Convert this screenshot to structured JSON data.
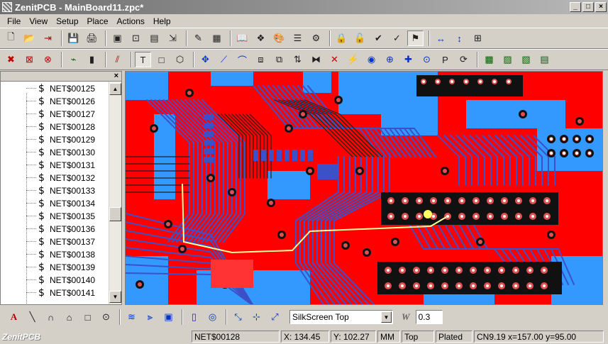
{
  "window": {
    "title": "ZenitPCB - MainBoard11.zpc*"
  },
  "menu": [
    "File",
    "View",
    "Setup",
    "Place",
    "Actions",
    "Help"
  ],
  "toolbar1": [
    "new-icon",
    "open-icon",
    "exit-icon",
    "save-icon",
    "print-icon",
    "board-icon",
    "component-icon",
    "pcb-icon",
    "export-icon",
    "edit-icon",
    "grid-icon",
    "library-icon",
    "layers-icon",
    "palette-icon",
    "properties-icon",
    "design-rules-icon",
    "lock-icon",
    "unlock-icon",
    "check-icon",
    "drc-icon",
    "online-drc-icon",
    "dimension-h-icon",
    "dimension-v-icon",
    "set-icon"
  ],
  "toolbar2": [
    "delete-icon",
    "delete-trace-icon",
    "delete-via-icon",
    "ratsnest-icon",
    "component-pin-icon",
    "route-icon",
    "text-icon",
    "rectangle-icon",
    "polygon-icon",
    "move-icon",
    "line-icon",
    "arc-icon",
    "component2-icon",
    "footprint-icon",
    "swap-icon",
    "gate-icon",
    "unroute-icon",
    "autoroute-icon",
    "via-icon",
    "add-pad-icon",
    "add-cross-icon",
    "add-circle-icon",
    "pad-icon",
    "cycle-icon",
    "copper-icon",
    "copper2-icon",
    "copper3-icon",
    "report-icon"
  ],
  "netlist": {
    "items": [
      "NET$00125",
      "NET$00126",
      "NET$00127",
      "NET$00128",
      "NET$00129",
      "NET$00130",
      "NET$00131",
      "NET$00132",
      "NET$00133",
      "NET$00134",
      "NET$00135",
      "NET$00136",
      "NET$00137",
      "NET$00138",
      "NET$00139",
      "NET$00140",
      "NET$00141"
    ]
  },
  "drawbar": {
    "icons": [
      "text-tool-icon",
      "line-tool-icon",
      "arc-tool-icon",
      "shape-tool-icon",
      "rect-tool-icon",
      "circle-tool-icon",
      "hatch-icon",
      "center-icon",
      "fill-icon",
      "pin-icon",
      "pad-settings-icon",
      "measure-icon",
      "snap-icon",
      "route-tool-icon"
    ],
    "layer": "SilkScreen Top",
    "width_label": "W",
    "width_value": "0.3"
  },
  "status": {
    "brand": "ZenitPCB",
    "net": "NET$00128",
    "x": "X: 134.45",
    "y": "Y: 102.27",
    "units": "MM",
    "side": "Top",
    "plating": "Plated",
    "component": "CN9.19  x=157.00 y=95.00"
  },
  "colors": {
    "top_copper": "#ff0000",
    "bottom_copper": "#3399ff",
    "traces_bottom": "#3c50c8",
    "highlight": "#ffff99"
  }
}
